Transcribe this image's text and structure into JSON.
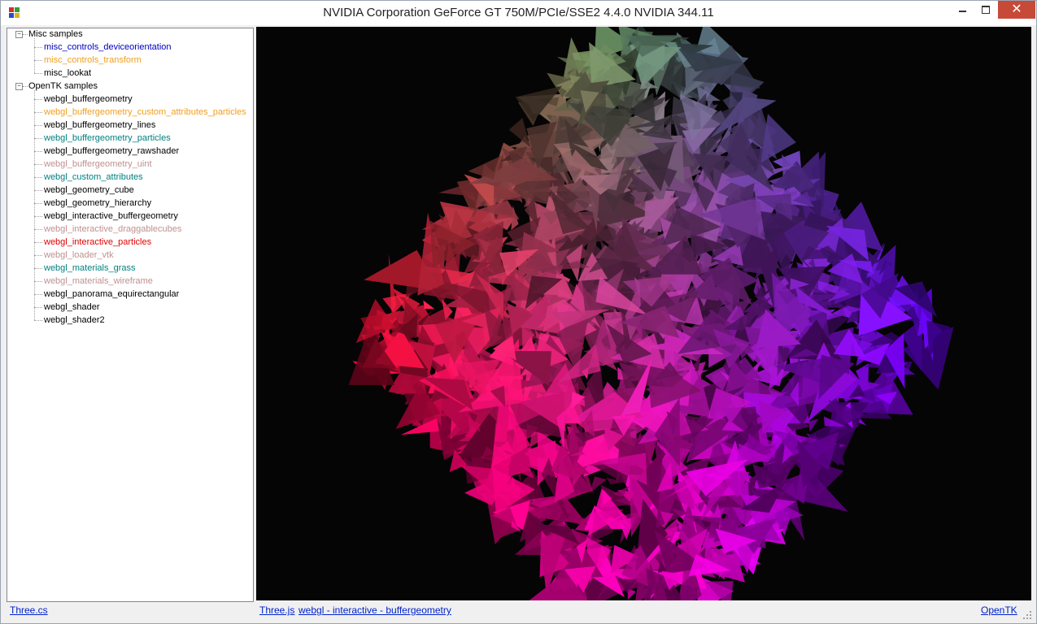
{
  "window": {
    "title": "NVIDIA Corporation GeForce GT 750M/PCIe/SSE2 4.4.0 NVIDIA 344.11",
    "minimize_glyph": "",
    "close_glyph": "✕"
  },
  "tree": {
    "groups": [
      {
        "label": "Misc samples",
        "expander": "−",
        "items": [
          {
            "label": "misc_controls_deviceorientation",
            "color": "#0000c0"
          },
          {
            "label": "misc_controls_transform",
            "color": "#f0a020"
          },
          {
            "label": "misc_lookat",
            "color": "#000000"
          }
        ]
      },
      {
        "label": "OpenTK samples",
        "expander": "−",
        "items": [
          {
            "label": "webgl_buffergeometry",
            "color": "#000000"
          },
          {
            "label": "webgl_buffergeometry_custom_attributes_particles",
            "color": "#f0a020"
          },
          {
            "label": "webgl_buffergeometry_lines",
            "color": "#000000"
          },
          {
            "label": "webgl_buffergeometry_particles",
            "color": "#008080"
          },
          {
            "label": "webgl_buffergeometry_rawshader",
            "color": "#000000"
          },
          {
            "label": "webgl_buffergeometry_uint",
            "color": "#c09090"
          },
          {
            "label": "webgl_custom_attributes",
            "color": "#008080"
          },
          {
            "label": "webgl_geometry_cube",
            "color": "#000000"
          },
          {
            "label": "webgl_geometry_hierarchy",
            "color": "#000000"
          },
          {
            "label": "webgl_interactive_buffergeometry",
            "color": "#000000"
          },
          {
            "label": "webgl_interactive_draggablecubes",
            "color": "#c09090"
          },
          {
            "label": "webgl_interactive_particles",
            "color": "#e00000"
          },
          {
            "label": "webgl_loader_vtk",
            "color": "#c09090"
          },
          {
            "label": "webgl_materials_grass",
            "color": "#008080"
          },
          {
            "label": "webgl_materials_wireframe",
            "color": "#c09090"
          },
          {
            "label": "webgl_panorama_equirectangular",
            "color": "#000000"
          },
          {
            "label": "webgl_shader",
            "color": "#000000"
          },
          {
            "label": "webgl_shader2",
            "color": "#000000"
          }
        ]
      }
    ]
  },
  "status": {
    "left_link": "Three.cs",
    "threejs_link": "Three.js",
    "sample_link": "webgl - interactive - buffergeometry",
    "right_link": "OpenTK"
  },
  "colors": {
    "link": "#0022cc",
    "viewport_bg": "#050505",
    "close_button": "#c74a38"
  },
  "icons": {
    "app": "app-icon",
    "minimize": "minimize-icon",
    "maximize": "maximize-icon",
    "close": "close-icon",
    "resize_grip": "resize-grip-icon"
  }
}
